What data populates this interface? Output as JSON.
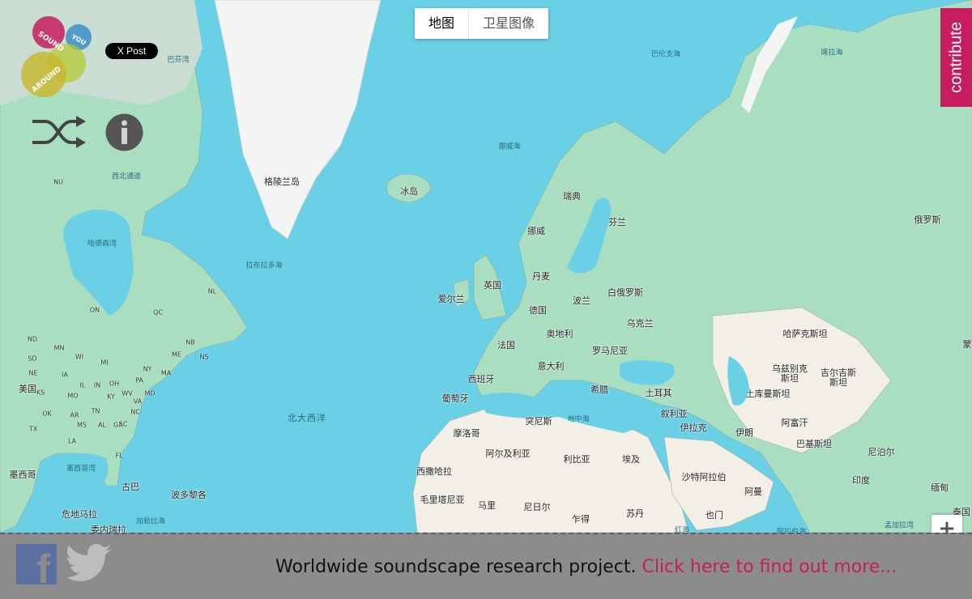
{
  "map": {
    "type_buttons": {
      "map": "地图",
      "satellite": "卫星图像"
    },
    "labels": {
      "greenland": "格陵兰岛",
      "iceland": "冰岛",
      "sweden": "瑞典",
      "finland": "芬兰",
      "norway": "挪威",
      "russia": "俄罗斯",
      "denmark": "丹麦",
      "uk": "英国",
      "ireland": "爱尔兰",
      "germany": "德国",
      "poland": "波兰",
      "belarus": "白俄罗斯",
      "ukraine": "乌克兰",
      "austria": "奥地利",
      "france": "法国",
      "romania": "罗马尼亚",
      "italy": "意大利",
      "spain": "西班牙",
      "portugal": "葡萄牙",
      "greece": "希腊",
      "turkey": "土耳其",
      "kazakhstan": "哈萨克斯坦",
      "uzbekistan": "乌兹别克斯坦",
      "kyrgyzstan": "吉尔吉斯斯坦",
      "turkmenistan": "土库曼斯坦",
      "syria": "叙利亚",
      "iraq": "伊拉克",
      "iran": "伊朗",
      "afghanistan": "阿富汗",
      "pakistan": "巴基斯坦",
      "nepal": "尼泊尔",
      "india": "印度",
      "myanmar": "缅甸",
      "thailand": "泰国",
      "morocco": "摩洛哥",
      "tunisia": "突尼斯",
      "algeria": "阿尔及利亚",
      "libya": "利比亚",
      "egypt": "埃及",
      "saudi": "沙特阿拉伯",
      "oman": "阿曼",
      "yemen": "也门",
      "w_sahara": "西撒哈拉",
      "mauritania": "毛里塔尼亚",
      "mali": "马里",
      "niger": "尼日尔",
      "chad": "乍得",
      "sudan": "苏丹",
      "usa": "美国",
      "mexico": "墨西哥",
      "cuba": "古巴",
      "pr": "波多黎各",
      "guatemala": "危地马拉",
      "venezuela": "委内瑞拉",
      "mongolia": "蒙",
      "hudson_bay": "哈德森湾",
      "baffin_bay": "巴芬湾",
      "labrador_sea": "拉布拉多海",
      "nw_passage": "西北通道",
      "norwegian_sea": "挪威海",
      "barents_sea": "巴伦支海",
      "kara_sea": "喀拉海",
      "n_atlantic": "北大西洋",
      "mediterranean": "地中海",
      "gulf_mexico": "墨西哥湾",
      "caribbean": "加勒比海",
      "red_sea": "红海",
      "arabian_sea": "阿拉伯海",
      "bay_bengal": "孟加拉湾",
      "nu": "NU",
      "qc": "QC",
      "on": "ON",
      "nl": "NL",
      "nb": "NB",
      "ns": "NS",
      "me": "ME",
      "ny": "NY",
      "ma": "MA",
      "pa": "PA",
      "mn": "MN",
      "nd": "ND",
      "sd": "SD",
      "ne": "NE",
      "ks": "KS",
      "ok": "OK",
      "tx": "TX",
      "ia": "IA",
      "mo": "MO",
      "ar": "AR",
      "la": "LA",
      "ms": "MS",
      "al": "AL",
      "ga": "GA",
      "fl": "FL",
      "tn": "TN",
      "ky": "KY",
      "in": "IN",
      "il": "IL",
      "oh": "OH",
      "wv": "WV",
      "va": "VA",
      "nc": "NC",
      "sc": "SC",
      "wi": "WI",
      "mi": "MI",
      "md": "MD"
    }
  },
  "contribute": "contribute",
  "logo": {
    "sound": "SOUND",
    "you": "YOU",
    "around": "AROUND"
  },
  "social": {
    "x_post": "X Post"
  },
  "footer": {
    "tagline": "Worldwide soundscape research project.",
    "link": "Click here to find out more..."
  },
  "zoom": {
    "plus": "+"
  },
  "colors": {
    "ocean": "#6ad0e5",
    "land": "#a9dfc0",
    "accent": "#c51d5e",
    "footer": "#8c8c8c"
  }
}
